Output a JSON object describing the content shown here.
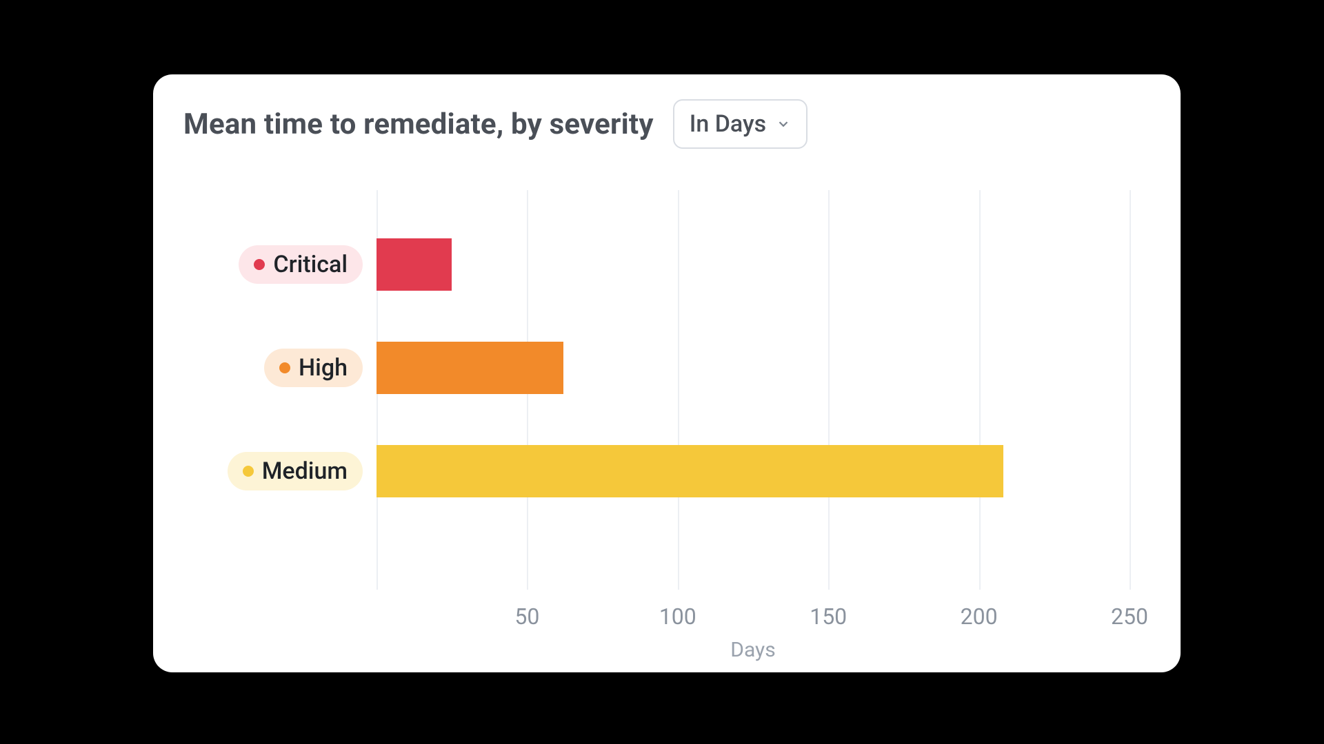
{
  "card": {
    "title": "Mean time to remediate, by severity",
    "unit_selector": {
      "label": "In Days"
    }
  },
  "chart_data": {
    "type": "bar",
    "orientation": "horizontal",
    "categories": [
      "Critical",
      "High",
      "Medium"
    ],
    "values": [
      25,
      62,
      208
    ],
    "colors": [
      "#e13b4f",
      "#f28a2a",
      "#f5c83a"
    ],
    "pill_bg": [
      "#fde6e9",
      "#fde9d6",
      "#fdf4d6"
    ],
    "xlabel": "Days",
    "ylabel": "",
    "title": "Mean time to remediate, by severity",
    "xlim": [
      0,
      250
    ],
    "xticks": [
      50,
      100,
      150,
      200,
      250
    ],
    "xtick_labels": [
      "50",
      "100",
      "150",
      "200",
      "250"
    ],
    "grid": true
  }
}
